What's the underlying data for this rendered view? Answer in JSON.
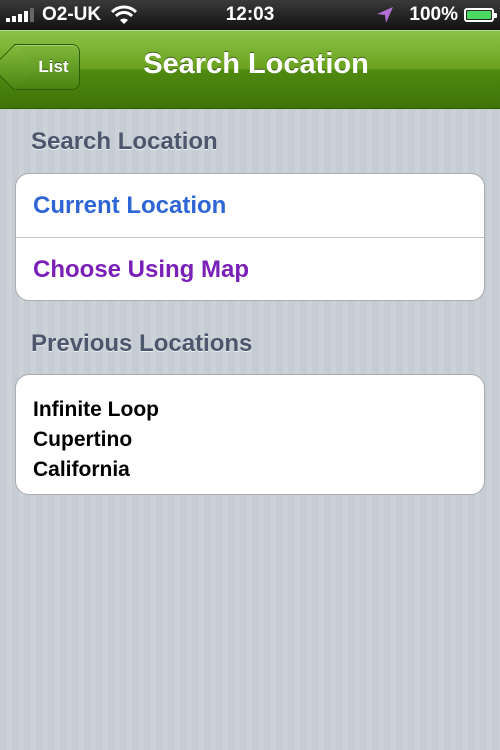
{
  "status_bar": {
    "carrier": "O2-UK",
    "time": "12:03",
    "battery": "100%",
    "battery_level": 1.0,
    "icons": [
      "signal-bars-icon",
      "wifi-icon",
      "location-arrow-icon",
      "battery-icon"
    ]
  },
  "nav": {
    "back_label": "List",
    "title": "Search Location"
  },
  "search_section": {
    "header": "Search Location",
    "items": [
      "Current Location",
      "Choose Using Map"
    ]
  },
  "previous_section": {
    "header": "Previous Locations",
    "locations": [
      {
        "lines": [
          "Infinite Loop",
          "Cupertino",
          "California"
        ]
      }
    ]
  },
  "colors": {
    "nav_green": "#6aa21e",
    "current_location_blue": "#2f66d6",
    "choose_map_purple": "#7a1fb8",
    "section_header": "#4c566c"
  }
}
